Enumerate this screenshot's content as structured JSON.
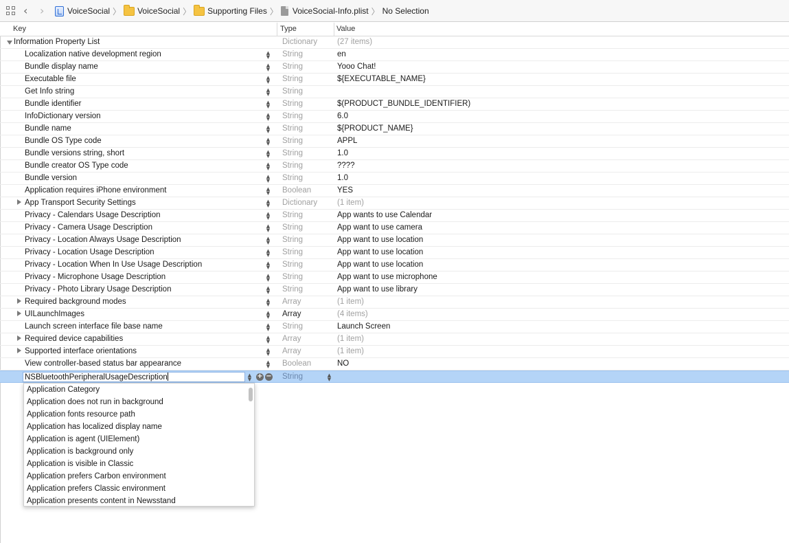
{
  "breadcrumbs": [
    {
      "label": "VoiceSocial",
      "icon": "xcode-project-icon"
    },
    {
      "label": "VoiceSocial",
      "icon": "folder-icon"
    },
    {
      "label": "Supporting Files",
      "icon": "folder-icon"
    },
    {
      "label": "VoiceSocial-Info.plist",
      "icon": "file-icon"
    },
    {
      "label": "No Selection",
      "icon": ""
    }
  ],
  "columns": {
    "key": "Key",
    "type": "Type",
    "value": "Value"
  },
  "root": {
    "key": "Information Property List",
    "type": "Dictionary",
    "value": "(27 items)"
  },
  "rows": [
    {
      "key": "Localization native development region",
      "type": "String",
      "value": "en",
      "expandable": false
    },
    {
      "key": "Bundle display name",
      "type": "String",
      "value": "Yooo Chat!",
      "expandable": false
    },
    {
      "key": "Executable file",
      "type": "String",
      "value": "${EXECUTABLE_NAME}",
      "expandable": false
    },
    {
      "key": "Get Info string",
      "type": "String",
      "value": "",
      "expandable": false
    },
    {
      "key": "Bundle identifier",
      "type": "String",
      "value": "$(PRODUCT_BUNDLE_IDENTIFIER)",
      "expandable": false
    },
    {
      "key": "InfoDictionary version",
      "type": "String",
      "value": "6.0",
      "expandable": false
    },
    {
      "key": "Bundle name",
      "type": "String",
      "value": "${PRODUCT_NAME}",
      "expandable": false
    },
    {
      "key": "Bundle OS Type code",
      "type": "String",
      "value": "APPL",
      "expandable": false
    },
    {
      "key": "Bundle versions string, short",
      "type": "String",
      "value": "1.0",
      "expandable": false
    },
    {
      "key": "Bundle creator OS Type code",
      "type": "String",
      "value": "????",
      "expandable": false
    },
    {
      "key": "Bundle version",
      "type": "String",
      "value": "1.0",
      "expandable": false
    },
    {
      "key": "Application requires iPhone environment",
      "type": "Boolean",
      "value": "YES",
      "expandable": false
    },
    {
      "key": "App Transport Security Settings",
      "type": "Dictionary",
      "value": "(1 item)",
      "expandable": true
    },
    {
      "key": "Privacy - Calendars Usage Description",
      "type": "String",
      "value": "App wants to use Calendar",
      "expandable": false
    },
    {
      "key": "Privacy - Camera Usage Description",
      "type": "String",
      "value": "App want to  use camera",
      "expandable": false
    },
    {
      "key": "Privacy - Location Always Usage Description",
      "type": "String",
      "value": "App want to  use location",
      "expandable": false
    },
    {
      "key": "Privacy - Location Usage Description",
      "type": "String",
      "value": "App want to  use location",
      "expandable": false
    },
    {
      "key": "Privacy - Location When In Use Usage Description",
      "type": "String",
      "value": "App want to  use location",
      "expandable": false
    },
    {
      "key": "Privacy - Microphone Usage Description",
      "type": "String",
      "value": "App want to  use microphone",
      "expandable": false
    },
    {
      "key": "Privacy - Photo Library Usage Description",
      "type": "String",
      "value": "App want to  use library",
      "expandable": false
    },
    {
      "key": "Required background modes",
      "type": "Array",
      "value": "(1 item)",
      "expandable": true
    },
    {
      "key": "UILaunchImages",
      "type": "Array",
      "value": "(4 items)",
      "expandable": true,
      "dark_type": true
    },
    {
      "key": "Launch screen interface file base name",
      "type": "String",
      "value": "Launch Screen",
      "expandable": false
    },
    {
      "key": "Required device capabilities",
      "type": "Array",
      "value": "(1 item)",
      "expandable": true
    },
    {
      "key": "Supported interface orientations",
      "type": "Array",
      "value": "(1 item)",
      "expandable": true
    },
    {
      "key": "View controller-based status bar appearance",
      "type": "Boolean",
      "value": "NO",
      "expandable": false
    }
  ],
  "editing_row": {
    "key": "NSBluetoothPeripheralUsageDescription",
    "type": "String"
  },
  "suggestions": [
    "Application Category",
    "Application does not run in background",
    "Application fonts resource path",
    "Application has localized display name",
    "Application is agent (UIElement)",
    "Application is background only",
    "Application is visible in Classic",
    "Application prefers Carbon environment",
    "Application prefers Classic environment",
    "Application presents content in Newsstand"
  ],
  "colors": {
    "selection": "#b4d4f7",
    "type_grey": "#a0a0a0",
    "folder": "#f5c342"
  }
}
